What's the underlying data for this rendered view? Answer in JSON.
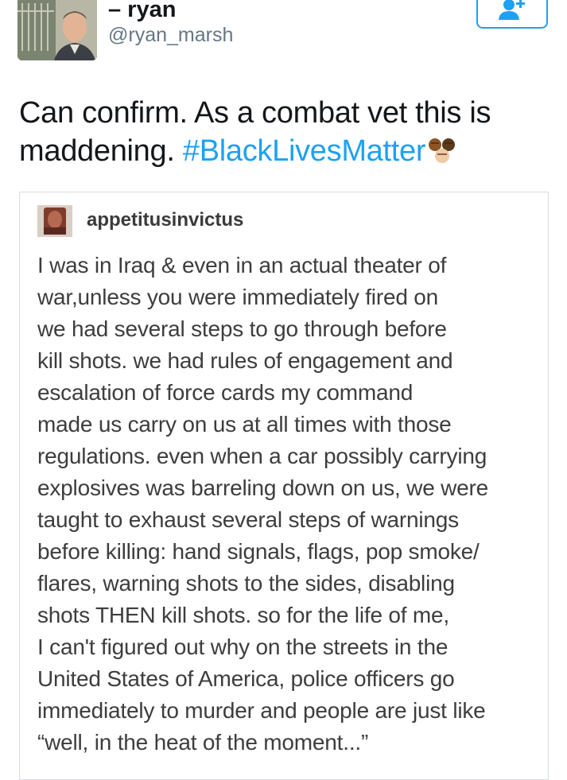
{
  "author": {
    "display_name": "– ryan",
    "handle": "@ryan_marsh"
  },
  "follow_button": {
    "icon": "follow-user-plus-icon",
    "accent_color": "#1da1f2"
  },
  "tweet": {
    "text_before_hashtag": "Can confirm. As a combat vet this is maddening. ",
    "hashtag": "#BlackLivesMatter",
    "emoji": "raised-fists-emoji"
  },
  "quoted_post": {
    "username": "appetitusinvictus",
    "lines": [
      "I was in Iraq & even in an actual theater of",
      "war,unless you were immediately fired on",
      "we had several steps to go through before",
      "kill shots. we had rules of engagement and",
      "escalation of force cards my command",
      "made us carry on us at all times with those",
      "regulations. even when a car possibly carrying",
      "explosives was barreling down on us, we were",
      "taught to exhaust several steps of warnings",
      "before killing: hand signals, flags, pop smoke/",
      "flares, warning shots to the sides, disabling",
      "shots THEN kill shots. so for the life of me,",
      "I can't figured out why on the streets in the",
      "United States of America, police officers go",
      "immediately to murder and people are just like",
      "“well, in the heat of the moment...”"
    ]
  }
}
